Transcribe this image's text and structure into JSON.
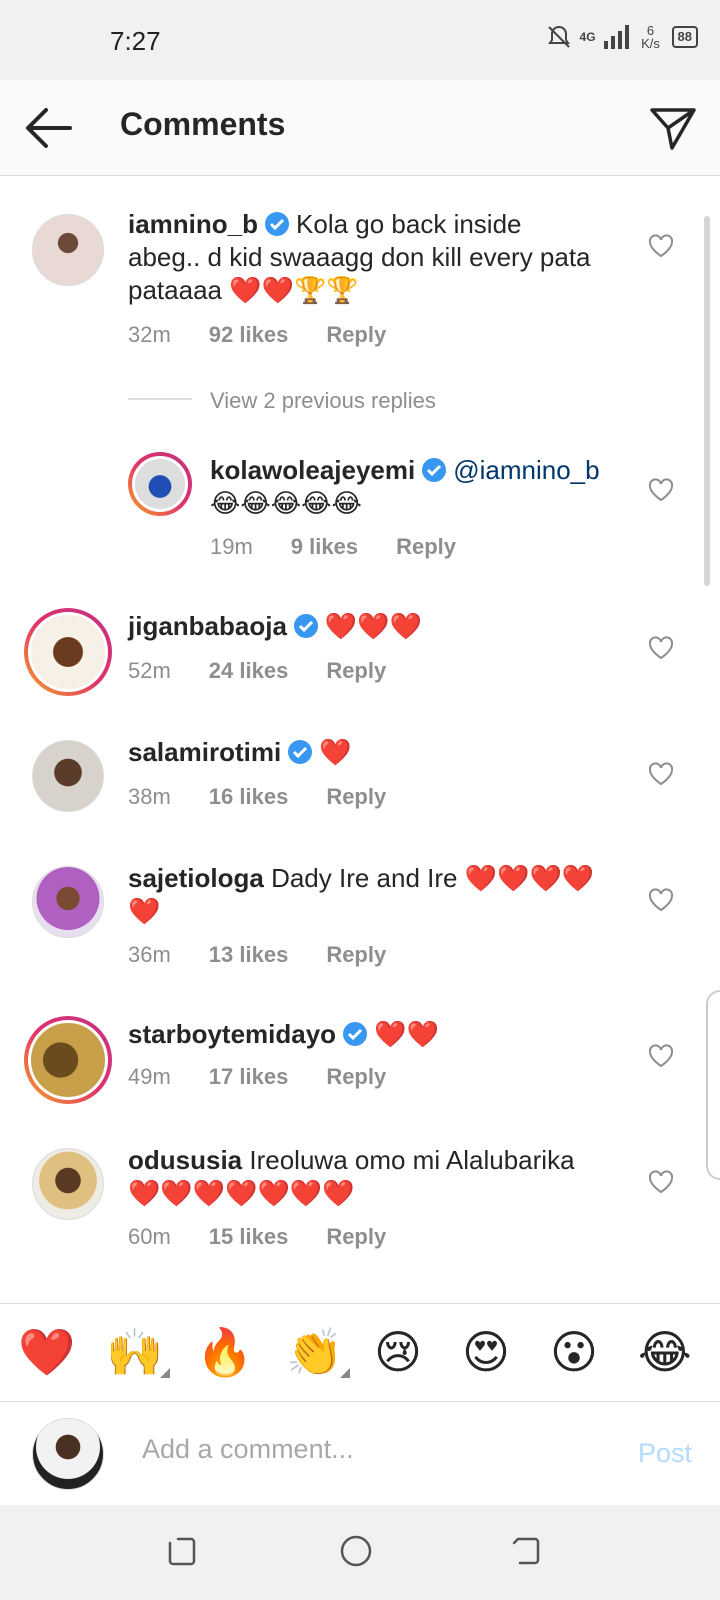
{
  "status": {
    "time": "7:27",
    "network": "4G",
    "speed": "6 K/s",
    "battery": "88"
  },
  "header": {
    "title": "Comments"
  },
  "comments": [
    {
      "user": "iamnino_b",
      "verified": true,
      "text_line1": "Kola go back inside",
      "text_line2": "abeg.. d kid swaaagg don kill every pata",
      "text_line3": "pataaaa ❤️❤️🏆🏆",
      "time": "32m",
      "likes": "92 likes",
      "reply": "Reply"
    },
    {
      "view_replies": "View 2 previous replies"
    },
    {
      "user": "kolawoleajeyemi",
      "verified": true,
      "mention": "@iamnino_b",
      "text_line2": "😂😂😂😂😂",
      "time": "19m",
      "likes": "9 likes",
      "reply": "Reply"
    },
    {
      "user": "jiganbabaoja",
      "verified": true,
      "text": "❤️❤️❤️",
      "time": "52m",
      "likes": "24 likes",
      "reply": "Reply"
    },
    {
      "user": "salamirotimi",
      "verified": true,
      "text": "❤️",
      "time": "38m",
      "likes": "16 likes",
      "reply": "Reply"
    },
    {
      "user": "sajetiologa",
      "verified": false,
      "text_line1": "Dady Ire and Ire ❤️❤️❤️❤️",
      "text_line2": "❤️",
      "time": "36m",
      "likes": "13 likes",
      "reply": "Reply"
    },
    {
      "user": "starboytemidayo",
      "verified": true,
      "text": "❤️❤️",
      "time": "49m",
      "likes": "17 likes",
      "reply": "Reply"
    },
    {
      "user": "odususia",
      "verified": false,
      "text_line1": "Ireoluwa omo mi Alalubarika",
      "text_line2": "❤️❤️❤️❤️❤️❤️❤️",
      "time": "60m",
      "likes": "15 likes",
      "reply": "Reply"
    }
  ],
  "emoji_bar": [
    "❤️",
    "🙌",
    "🔥",
    "👏",
    "😢",
    "😍",
    "😮",
    "😂"
  ],
  "composer": {
    "placeholder": "Add a comment...",
    "post": "Post"
  }
}
